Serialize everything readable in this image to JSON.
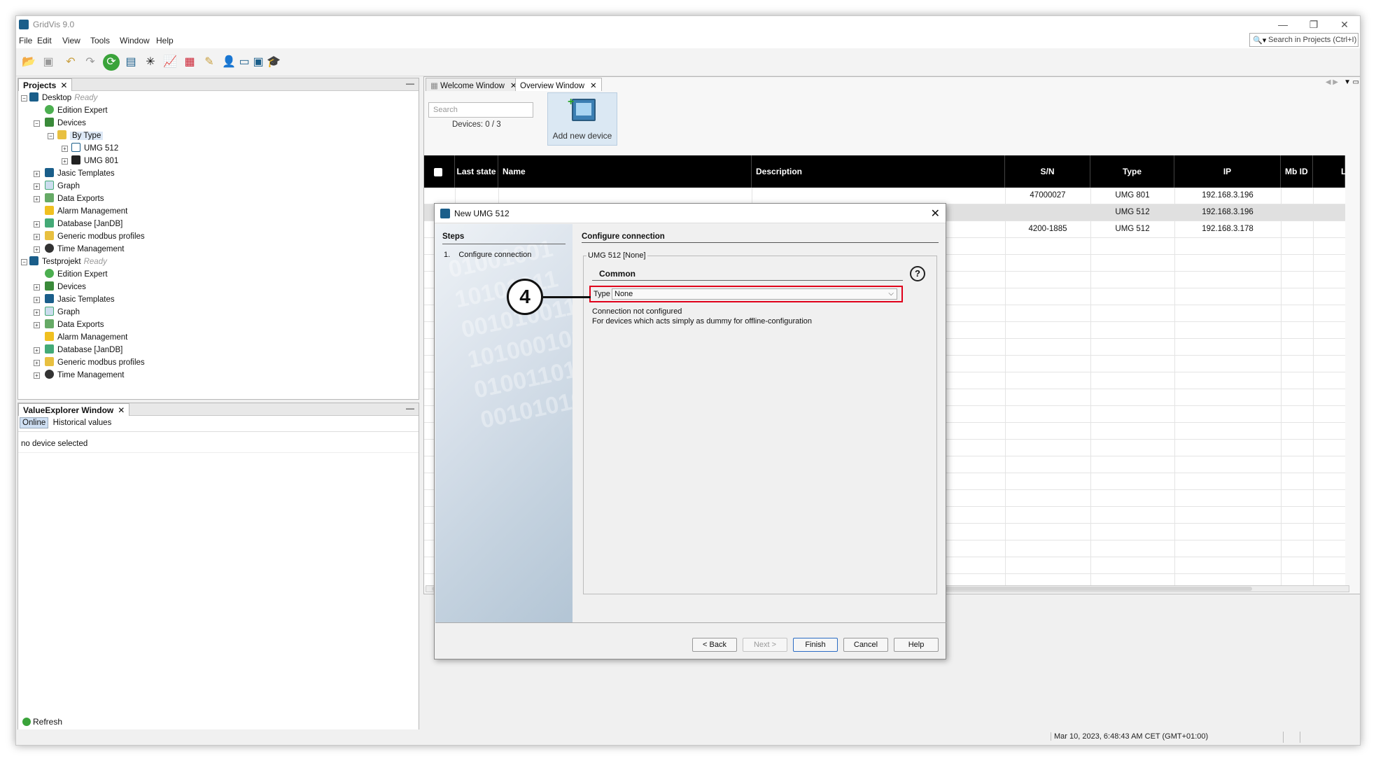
{
  "app": {
    "title": "GridVis 9.0"
  },
  "menu": [
    "File",
    "Edit",
    "View",
    "Tools",
    "Window",
    "Help"
  ],
  "search_projects": {
    "placeholder": "Search in Projects (Ctrl+I)"
  },
  "projects_panel": {
    "tab": "Projects",
    "tree": [
      {
        "label": "Desktop",
        "status": "Ready"
      },
      {
        "label": "Edition Expert"
      },
      {
        "label": "Devices"
      },
      {
        "label": "By Type"
      },
      {
        "label": "UMG 512"
      },
      {
        "label": "UMG 801"
      },
      {
        "label": "Jasic Templates"
      },
      {
        "label": "Graph"
      },
      {
        "label": "Data Exports"
      },
      {
        "label": "Alarm Management"
      },
      {
        "label": "Database [JanDB]"
      },
      {
        "label": "Generic modbus profiles"
      },
      {
        "label": "Time Management"
      },
      {
        "label": "Testprojekt",
        "status": "Ready"
      },
      {
        "label": "Edition Expert"
      },
      {
        "label": "Devices"
      },
      {
        "label": "Jasic Templates"
      },
      {
        "label": "Graph"
      },
      {
        "label": "Data Exports"
      },
      {
        "label": "Alarm Management"
      },
      {
        "label": "Database [JanDB]"
      },
      {
        "label": "Generic modbus profiles"
      },
      {
        "label": "Time Management"
      }
    ]
  },
  "value_explorer": {
    "tab": "ValueExplorer Window",
    "tabs": [
      "Online",
      "Historical values"
    ],
    "empty": "no device selected",
    "refresh": "Refresh"
  },
  "doc_tabs": [
    "Welcome Window",
    "Overview Window"
  ],
  "overview": {
    "search_placeholder": "Search",
    "devices_count": "Devices: 0 / 3",
    "add_device": "Add new device",
    "columns": [
      "Last state",
      "Name",
      "Description",
      "S/N",
      "Type",
      "IP",
      "Mb ID",
      "L"
    ],
    "rows": [
      {
        "sn": "47000027",
        "type": "UMG 801",
        "ip": "192.168.3.196"
      },
      {
        "sn": "",
        "type": "UMG 512",
        "ip": "192.168.3.196"
      },
      {
        "sn": "4200-1885",
        "type": "UMG 512",
        "ip": "192.168.3.178"
      }
    ]
  },
  "dialog": {
    "title": "New UMG 512",
    "steps_title": "Steps",
    "step1_num": "1.",
    "step1": "Configure connection",
    "config_title": "Configure connection",
    "fieldset": "UMG 512 [None]",
    "common": "Common",
    "help": "?",
    "type_label": "Type",
    "type_value": "None",
    "info1": "Connection not configured",
    "info2": "For devices which acts simply as dummy for offline-configuration",
    "buttons": {
      "back": "< Back",
      "next": "Next >",
      "finish": "Finish",
      "cancel": "Cancel",
      "help": "Help"
    },
    "watermark": [
      "01001001",
      "10101011",
      "00101001100",
      "1010001011",
      "01001101",
      "00101010"
    ]
  },
  "callout": "4",
  "status": {
    "datetime": "Mar 10, 2023, 6:48:43 AM CET (GMT+01:00)"
  },
  "colors": {
    "highlight": "#e0001b",
    "header_bg": "#000000",
    "brand": "#1a5e8a"
  }
}
